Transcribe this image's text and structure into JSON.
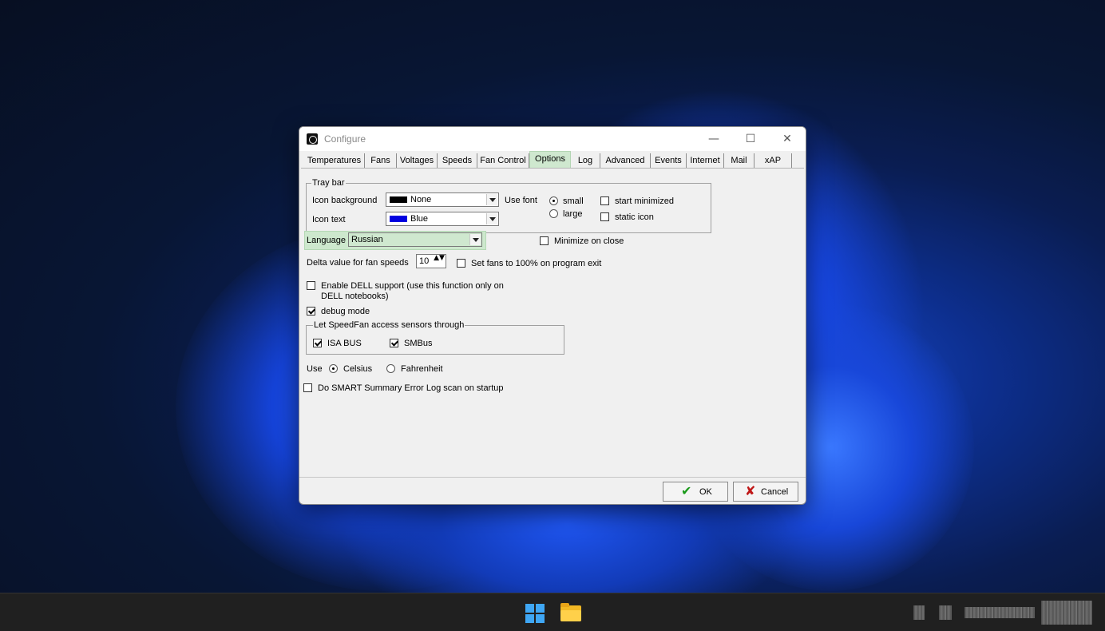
{
  "window": {
    "title": "Configure",
    "min_glyph": "—",
    "max_glyph": "☐",
    "close_glyph": "✕"
  },
  "tabs": [
    "Temperatures",
    "Fans",
    "Voltages",
    "Speeds",
    "Fan Control",
    "Options",
    "Log",
    "Advanced",
    "Events",
    "Internet",
    "Mail",
    "xAP"
  ],
  "active_tab": "Options",
  "tray_bar": {
    "group_label": "Tray bar",
    "icon_background_label": "Icon background",
    "icon_background_value": "None",
    "icon_background_color": "#000000",
    "icon_text_label": "Icon text",
    "icon_text_value": "Blue",
    "icon_text_color": "#0000e0",
    "use_font_label": "Use font",
    "font_small_label": "small",
    "font_large_label": "large",
    "font_selected": "small",
    "start_minimized_label": "start minimized",
    "start_minimized_checked": false,
    "static_icon_label": "static icon",
    "static_icon_checked": false
  },
  "language": {
    "label": "Language",
    "value": "Russian",
    "highlight_color": "#cde8cd"
  },
  "minimize_on_close": {
    "label": "Minimize on close",
    "checked": false
  },
  "delta": {
    "label": "Delta value for fan speeds",
    "value": "10",
    "spin_glyph": "▲▼"
  },
  "set_fans_exit": {
    "label": "Set fans to 100% on program exit",
    "checked": false
  },
  "dell_support": {
    "label_line1": "Enable DELL support (use this function only on",
    "label_line2": "DELL notebooks)",
    "checked": false
  },
  "debug_mode": {
    "label": "debug mode",
    "checked": true
  },
  "sensors": {
    "group_label": "Let SpeedFan access sensors through",
    "isa_bus_label": "ISA BUS",
    "isa_bus_checked": true,
    "smbus_label": "SMBus",
    "smbus_checked": true
  },
  "units": {
    "use_label": "Use",
    "celsius_label": "Celsius",
    "fahrenheit_label": "Fahrenheit",
    "selected": "Celsius"
  },
  "smart_scan": {
    "label": "Do SMART Summary Error Log scan on startup",
    "checked": false
  },
  "buttons": {
    "ok_label": "OK",
    "ok_glyph": "✔",
    "ok_color": "#1a9a1a",
    "cancel_label": "Cancel",
    "cancel_glyph": "✘",
    "cancel_color": "#c01818"
  },
  "taskbar": {
    "start_icon": "windows-start-icon",
    "explorer_icon": "file-explorer-icon"
  }
}
